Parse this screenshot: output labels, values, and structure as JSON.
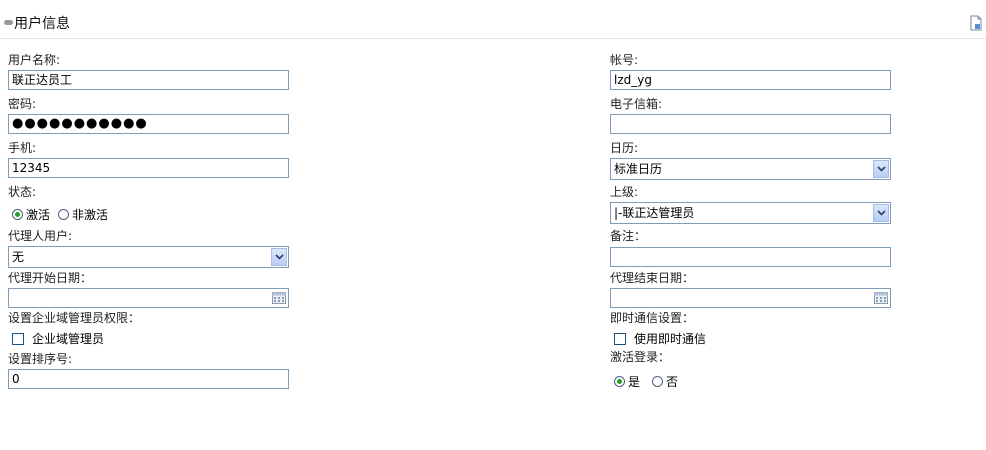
{
  "header": {
    "title": "用户信息"
  },
  "form": {
    "username": {
      "label": "用户名称:",
      "value": "联正达员工"
    },
    "account": {
      "label": "帐号:",
      "value": "lzd_yg"
    },
    "password": {
      "label": "密码:",
      "value": "●●●●●●●●●●●"
    },
    "email": {
      "label": "电子信箱:",
      "value": ""
    },
    "mobile": {
      "label": "手机:",
      "value": "12345"
    },
    "calendar": {
      "label": "日历:",
      "selected": "标准日历"
    },
    "status": {
      "label": "状态:",
      "options": [
        "激活",
        "非激活"
      ],
      "selected": "激活"
    },
    "superior": {
      "label": "上级:",
      "selected": "|-联正达管理员"
    },
    "proxy_user": {
      "label": "代理人用户:",
      "selected": "无"
    },
    "remark": {
      "label": "备注：",
      "value": ""
    },
    "proxy_start": {
      "label": "代理开始日期：",
      "value": ""
    },
    "proxy_end": {
      "label": "代理结束日期：",
      "value": ""
    },
    "admin_rights": {
      "label": "设置企业域管理员权限：",
      "checkbox_label": "企业域管理员",
      "checked": false
    },
    "im_settings": {
      "label": "即时通信设置：",
      "checkbox_label": "使用即时通信",
      "checked": false
    },
    "sort_order": {
      "label": "设置排序号:",
      "value": "0"
    },
    "activate_login": {
      "label": "激活登录：",
      "options": [
        "是",
        "否"
      ],
      "selected": "是"
    }
  },
  "icons": {
    "header": "collapse-icon",
    "doc": "document-icon",
    "calendar": "calendar-icon",
    "dropdown": "chevron-down-icon"
  },
  "colors": {
    "border": "#7f9db9",
    "radio_dot": "#21a121",
    "arrow_bg": "#c5d6f7"
  }
}
